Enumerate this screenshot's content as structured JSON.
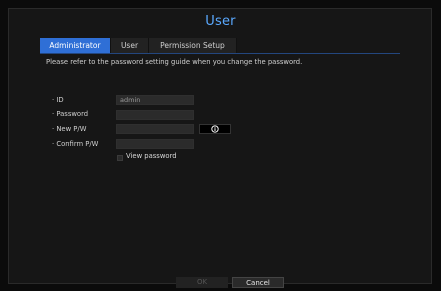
{
  "window": {
    "title": "User"
  },
  "tabs": [
    {
      "label": "Administrator",
      "active": true
    },
    {
      "label": "User",
      "active": false
    },
    {
      "label": "Permission Setup",
      "active": false
    }
  ],
  "guide_text": "Please refer to the password setting guide when you change the password.",
  "form": {
    "id_label": "· ID",
    "id_value": "admin",
    "password_label": "· Password",
    "new_pw_label": "· New P/W",
    "confirm_pw_label": "· Confirm P/W",
    "view_password_label": "View password"
  },
  "buttons": {
    "ok": "OK",
    "cancel": "Cancel"
  },
  "colors": {
    "accent": "#2f6fd6",
    "title": "#5aa9ff",
    "background": "#161616"
  }
}
